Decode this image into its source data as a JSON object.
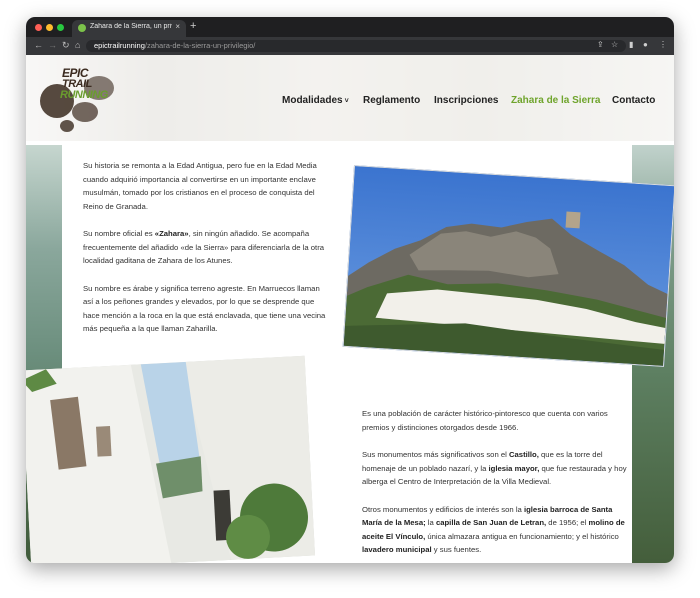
{
  "browser": {
    "tab_title": "Zahara de la Sierra, un privilegio",
    "tab_close": "×",
    "new_tab": "+",
    "url_domain": "epictrailrunning",
    "url_path": "/zahara-de-la-sierra-un-privilegio/"
  },
  "site": {
    "logo_lines": [
      "EPIC",
      "TRAIL",
      "RUNNING"
    ],
    "menu": [
      {
        "label": "Modalidades",
        "has_dropdown": true
      },
      {
        "label": "Reglamento"
      },
      {
        "label": "Inscripciones"
      },
      {
        "label": "Zahara de la Sierra",
        "active": true
      },
      {
        "label": "Contacto"
      }
    ],
    "menu_dropdown_glyph": "˅"
  },
  "content": {
    "left_paragraphs": [
      [
        {
          "t": "Su historia se remonta a la Edad Antigua, pero fue en la Edad Media cuando adquirió importancia al convertirse en un importante enclave musulmán, tomado por los cristianos en el proceso de conquista del Reino de Granada."
        }
      ],
      [
        {
          "t": "Su nombre oficial es "
        },
        {
          "t": "«Zahara»",
          "b": true
        },
        {
          "t": ", sin ningún añadido. Se acompaña frecuentemente del añadido «de la Sierra» para diferenciarla de la otra localidad gaditana de Zahara de los Atunes."
        }
      ],
      [
        {
          "t": "Su nombre es árabe y significa terreno agreste. En Marruecos llaman así a los peñones grandes y elevados, por lo que se desprende que hace mención a la roca en la que está enclavada, que tiene una vecina más pequeña a la que llaman Zaharilla."
        }
      ]
    ],
    "right_paragraphs": [
      [
        {
          "t": "Es una población de carácter histórico-pintoresco que cuenta con varios premios y distinciones otorgados desde 1966."
        }
      ],
      [
        {
          "t": "Sus monumentos más significativos son el "
        },
        {
          "t": "Castillo,",
          "b": true
        },
        {
          "t": " que es la torre del homenaje de un poblado nazarí, y la "
        },
        {
          "t": "iglesia mayor,",
          "b": true
        },
        {
          "t": " que fue restaurada y hoy alberga el Centro de Interpretación de la Villa Medieval."
        }
      ],
      [
        {
          "t": "Otros monumentos y edificios de interés son la "
        },
        {
          "t": "iglesia barroca de Santa María de la Mesa;",
          "b": true
        },
        {
          "t": " la "
        },
        {
          "t": "capilla de San Juan de Letran,",
          "b": true
        },
        {
          "t": " de 1956; el "
        },
        {
          "t": "molino de aceite El Vínculo,",
          "b": true
        },
        {
          "t": " única almazara antigua en funcionamiento; y el histórico "
        },
        {
          "t": "lavadero municipal",
          "b": true
        },
        {
          "t": " y sus fuentes."
        }
      ]
    ]
  },
  "colors": {
    "accent": "#6fa42c",
    "menu_text": "#222222",
    "body_text": "#333333"
  }
}
